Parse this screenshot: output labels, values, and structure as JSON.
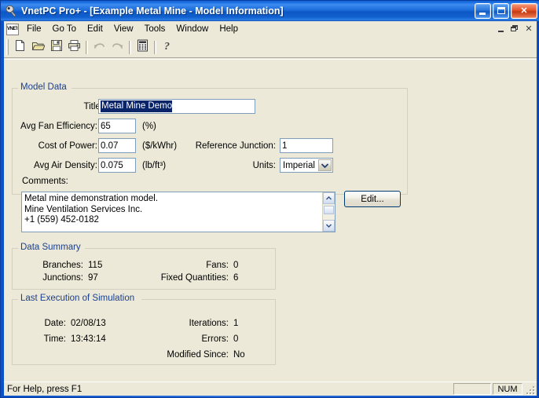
{
  "window": {
    "title": "VnetPC Pro+ - [Example Metal Mine - Model Information]",
    "app_icon": "vnet-app-icon",
    "minimize_label": "_",
    "maximize_label": "[]",
    "close_label": "✕",
    "accent_color": "#0b51c8",
    "face_color": "#ece9d8",
    "legend_color": "#1b3f8f",
    "selection_color": "#0a246a"
  },
  "mdi": {
    "icon_text": "VNET",
    "minimize_label": "_",
    "restore_label": "❐",
    "close_label": "✕"
  },
  "menu": {
    "items": [
      {
        "label": "File"
      },
      {
        "label": "Go To"
      },
      {
        "label": "Edit"
      },
      {
        "label": "View"
      },
      {
        "label": "Tools"
      },
      {
        "label": "Window"
      },
      {
        "label": "Help"
      }
    ]
  },
  "toolbar": {
    "buttons": [
      {
        "name": "new-icon",
        "enabled": true
      },
      {
        "name": "open-folder-icon",
        "enabled": true
      },
      {
        "name": "save-disk-icon",
        "enabled": true
      },
      {
        "name": "print-icon",
        "enabled": true
      },
      {
        "name": "undo-icon",
        "enabled": false
      },
      {
        "name": "redo-icon",
        "enabled": false
      },
      {
        "name": "calculator-icon",
        "enabled": true
      },
      {
        "name": "help-question-icon",
        "enabled": true
      }
    ]
  },
  "model_data": {
    "legend": "Model Data",
    "title_label": "Title:",
    "title_value": "Metal Mine Demo",
    "title_selected": true,
    "fan_efficiency_label": "Avg Fan Efficiency:",
    "fan_efficiency_value": "65",
    "fan_efficiency_units": "(%)",
    "cost_of_power_label": "Cost of Power:",
    "cost_of_power_value": "0.07",
    "cost_of_power_units": "($/kWhr)",
    "air_density_label": "Avg Air Density:",
    "air_density_value": "0.075",
    "air_density_units": "(lb/ft³)",
    "reference_junction_label": "Reference Junction:",
    "reference_junction_value": "1",
    "units_label": "Units:",
    "units_value": "Imperial",
    "comments_label": "Comments:",
    "comments_value": "Metal mine demonstration model.\nMine Ventilation Services Inc.\n+1 (559) 452-0182",
    "edit_button_label": "Edit..."
  },
  "data_summary": {
    "legend": "Data Summary",
    "branches_label": "Branches:",
    "branches_value": "115",
    "junctions_label": "Junctions:",
    "junctions_value": "97",
    "fans_label": "Fans:",
    "fans_value": "0",
    "fixed_quantities_label": "Fixed Quantities:",
    "fixed_quantities_value": "6"
  },
  "last_execution": {
    "legend": "Last Execution of Simulation",
    "date_label": "Date:",
    "date_value": "02/08/13",
    "time_label": "Time:",
    "time_value": "13:43:14",
    "iterations_label": "Iterations:",
    "iterations_value": "1",
    "errors_label": "Errors:",
    "errors_value": "0",
    "modified_since_label": "Modified Since:",
    "modified_since_value": "No"
  },
  "statusbar": {
    "message": "For Help, press F1",
    "pane_blank": "",
    "pane_num": "NUM"
  }
}
